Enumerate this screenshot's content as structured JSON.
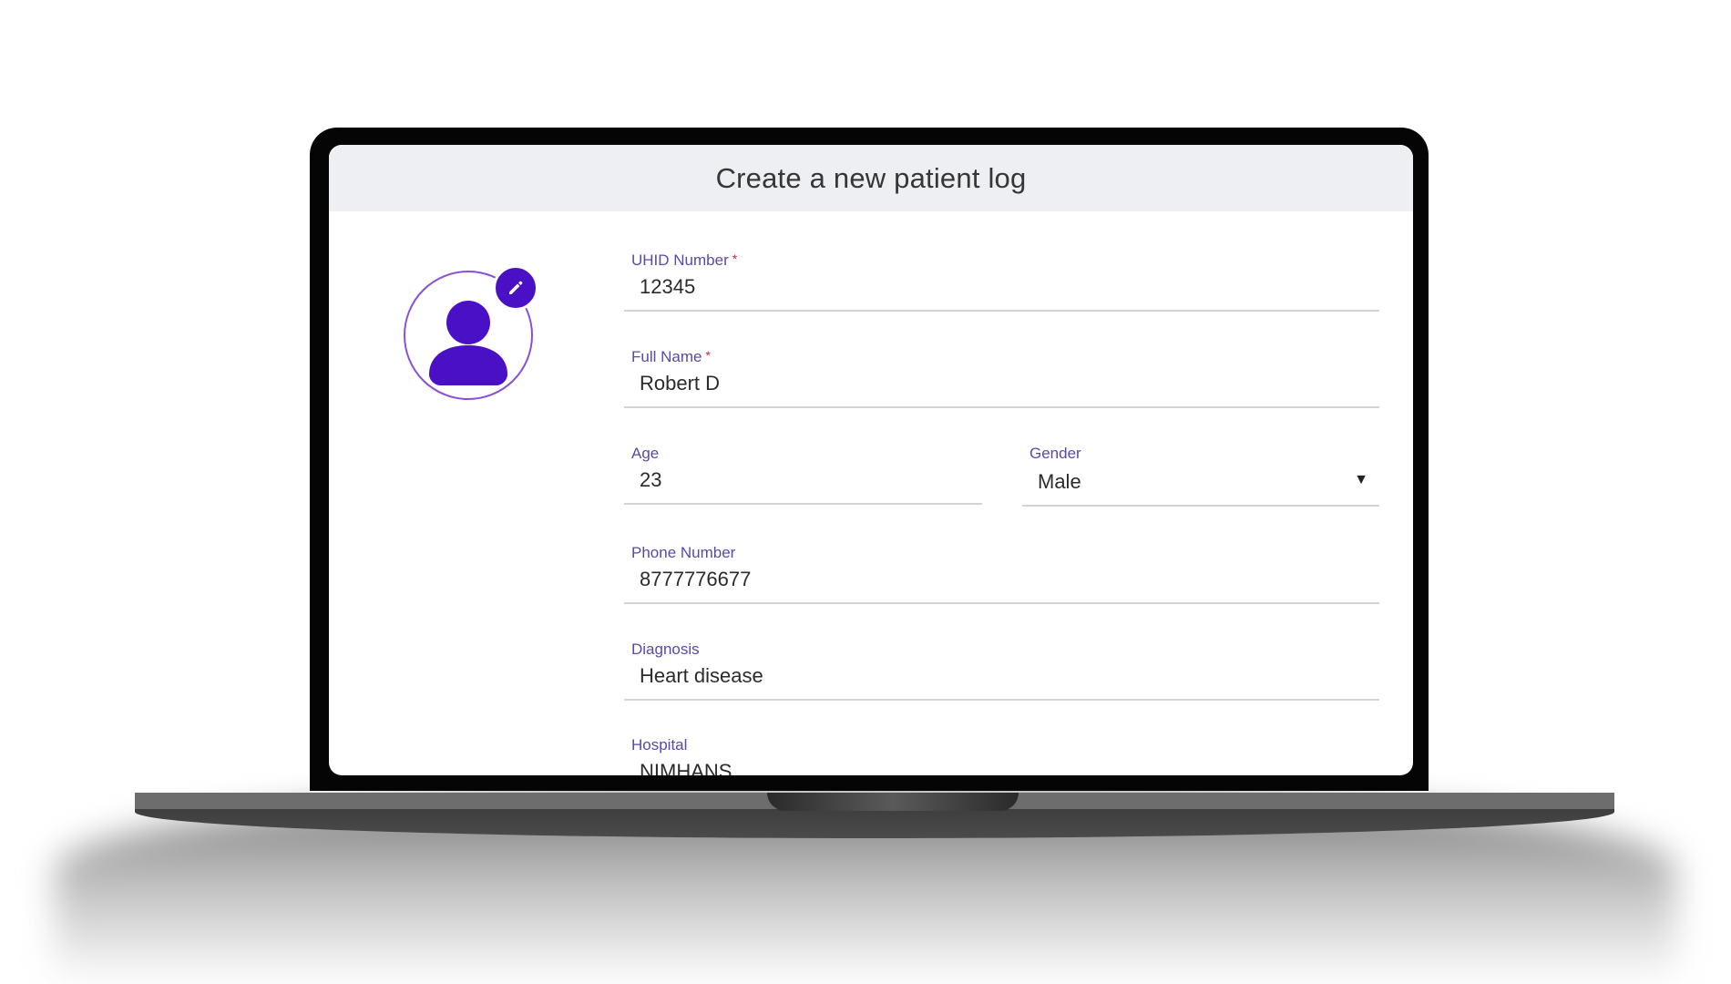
{
  "form": {
    "title": "Create a new patient log",
    "required_marker": "*",
    "fields": {
      "uhid": {
        "label": "UHID Number",
        "value": "12345",
        "required": true
      },
      "full_name": {
        "label": "Full Name",
        "value": "Robert D",
        "required": true
      },
      "age": {
        "label": "Age",
        "value": "23"
      },
      "gender": {
        "label": "Gender",
        "value": "Male",
        "arrow": "▼"
      },
      "phone": {
        "label": "Phone Number",
        "value": "8777776677"
      },
      "diagnosis": {
        "label": "Diagnosis",
        "value": "Heart disease"
      },
      "hospital": {
        "label": "Hospital",
        "value": "NIMHANS"
      }
    }
  },
  "avatar": {
    "icon": "user-icon",
    "edit_icon": "pencil-icon"
  },
  "colors": {
    "accent": "#4a10c6",
    "label": "#5a49a6",
    "required": "#d0243a",
    "header_bg": "#eeeff3"
  }
}
